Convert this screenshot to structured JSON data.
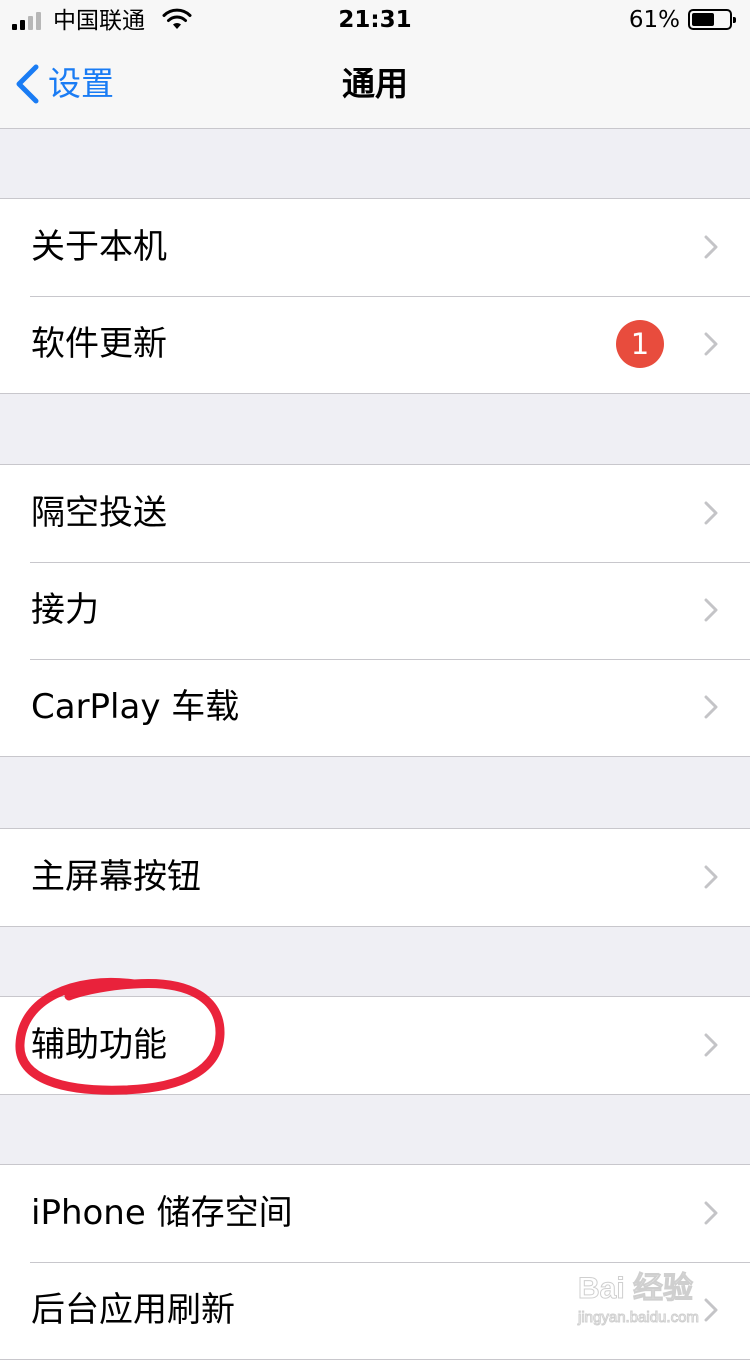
{
  "status_bar": {
    "carrier": "中国联通",
    "time": "21:31",
    "battery_percent": "61%",
    "battery_level": 0.61
  },
  "nav": {
    "back_label": "设置",
    "title": "通用"
  },
  "groups": [
    {
      "rows": [
        {
          "label": "关于本机"
        },
        {
          "label": "软件更新",
          "badge": "1"
        }
      ]
    },
    {
      "rows": [
        {
          "label": "隔空投送"
        },
        {
          "label": "接力"
        },
        {
          "label": "CarPlay 车载"
        }
      ]
    },
    {
      "rows": [
        {
          "label": "主屏幕按钮"
        }
      ]
    },
    {
      "rows": [
        {
          "label": "辅助功能"
        }
      ]
    },
    {
      "rows": [
        {
          "label": "iPhone 储存空间"
        },
        {
          "label": "后台应用刷新"
        }
      ]
    }
  ],
  "watermark": {
    "brand": "Bai 经验",
    "url": "jingyan.baidu.com"
  },
  "colors": {
    "accent": "#1a7cf4",
    "badge": "#e84c3d",
    "highlight": "#e8102a",
    "background": "#efeff4"
  }
}
